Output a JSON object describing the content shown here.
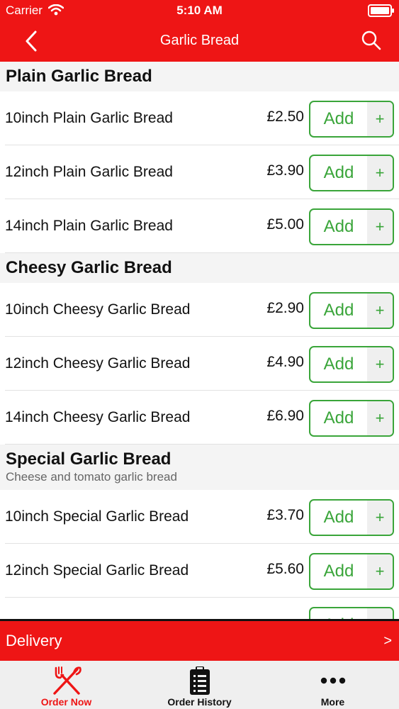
{
  "status_bar": {
    "carrier": "Carrier",
    "time": "5:10 AM"
  },
  "nav": {
    "title": "Garlic Bread",
    "back_icon": "chevron-left-icon",
    "search_icon": "search-icon"
  },
  "sections": [
    {
      "title": "Plain Garlic Bread",
      "subtitle": "",
      "items": [
        {
          "name": "10inch Plain Garlic Bread",
          "price": "£2.50",
          "add_label": "Add",
          "plus": "+"
        },
        {
          "name": "12inch Plain Garlic Bread",
          "price": "£3.90",
          "add_label": "Add",
          "plus": "+"
        },
        {
          "name": "14inch Plain Garlic Bread",
          "price": "£5.00",
          "add_label": "Add",
          "plus": "+"
        }
      ]
    },
    {
      "title": "Cheesy Garlic Bread",
      "subtitle": "",
      "items": [
        {
          "name": "10inch Cheesy Garlic Bread",
          "price": "£2.90",
          "add_label": "Add",
          "plus": "+"
        },
        {
          "name": "12inch Cheesy Garlic Bread",
          "price": "£4.90",
          "add_label": "Add",
          "plus": "+"
        },
        {
          "name": "14inch Cheesy Garlic Bread",
          "price": "£6.90",
          "add_label": "Add",
          "plus": "+"
        }
      ]
    },
    {
      "title": "Special Garlic Bread",
      "subtitle": "Cheese and tomato garlic bread",
      "items": [
        {
          "name": "10inch Special Garlic Bread",
          "price": "£3.70",
          "add_label": "Add",
          "plus": "+"
        },
        {
          "name": "12inch Special Garlic Bread",
          "price": "£5.60",
          "add_label": "Add",
          "plus": "+"
        },
        {
          "name": "",
          "price": "",
          "add_label": "Add",
          "plus": "+"
        }
      ]
    }
  ],
  "delivery_bar": {
    "label": "Delivery",
    "arrow": ">"
  },
  "tabs": [
    {
      "label": "Order Now",
      "icon": "fork-knife-icon",
      "active": true
    },
    {
      "label": "Order History",
      "icon": "clipboard-list-icon",
      "active": false
    },
    {
      "label": "More",
      "icon": "more-dots-icon",
      "active": false
    }
  ],
  "colors": {
    "brand_red": "#ee1515",
    "add_green": "#3aa53a",
    "tab_bg": "#efefef",
    "section_bg": "#f4f4f4"
  }
}
